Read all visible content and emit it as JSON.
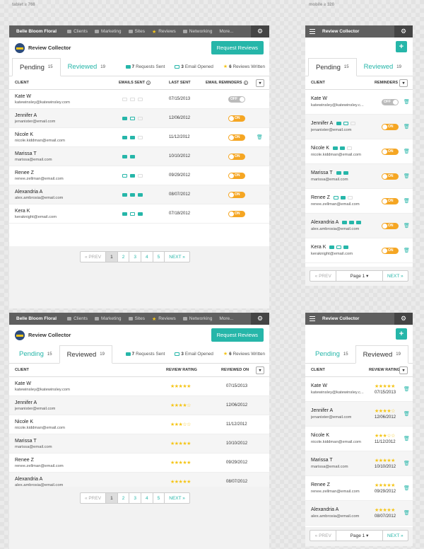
{
  "labels": {
    "tablet": "tablet ≥ 768",
    "mobile": "mobile ≥ 320"
  },
  "nav": {
    "brand": "Belle Bloom Floral",
    "items": [
      "Clients",
      "Marketing",
      "Sites",
      "Reviews",
      "Networking",
      "More..."
    ],
    "mobile_title": "Review Collector"
  },
  "app": {
    "title": "Review Collector",
    "request_button": "Request Reviews",
    "plus": "+"
  },
  "tabs": {
    "pending": "Pending",
    "pending_count": "15",
    "reviewed": "Reviewed",
    "reviewed_count": "19"
  },
  "stats": {
    "requests_sent_n": "7",
    "requests_sent": "Requests Sent",
    "email_opened_n": "3",
    "email_opened": "Email Opened",
    "reviews_written_n": "6",
    "reviews_written": "Reviews Written"
  },
  "headers": {
    "client": "CLIENT",
    "emails_sent": "EMAILS SENT",
    "last_sent": "LAST SENT",
    "email_reminders": "EMAIL REMINDERS",
    "reminders": "REMINDERS",
    "review_rating": "REVIEW RATING",
    "reviewed_on": "REVIEWED ON"
  },
  "clients": [
    {
      "name": "Kate W",
      "email": "katewinsley@katewinsley.com",
      "mobile_email": "katewinsley@katewinsley.c...",
      "last_sent": "07/15/2013",
      "reminder": "OFF",
      "stars": "★★★★★",
      "reviewed_on": "07/15/2013"
    },
    {
      "name": "Jennifer A",
      "email": "jenanister@email.com",
      "mobile_email": "jenanister@email.com",
      "last_sent": "12/06/2012",
      "reminder": "ON",
      "stars": "★★★★☆",
      "reviewed_on": "12/06/2012"
    },
    {
      "name": "Nicole K",
      "email": "nicole.kiddman@email.com",
      "mobile_email": "nicole.kiddman@email.com",
      "last_sent": "11/12/2012",
      "reminder": "ON",
      "stars": "★★★☆☆",
      "reviewed_on": "11/12/2012"
    },
    {
      "name": "Marissa T",
      "email": "marissa@email.com",
      "mobile_email": "marissa@email.com",
      "last_sent": "10/10/2012",
      "reminder": "ON",
      "stars": "★★★★★",
      "reviewed_on": "10/10/2012"
    },
    {
      "name": "Renee Z",
      "email": "renee.zellman@email.com",
      "mobile_email": "renee.zellman@email.com",
      "last_sent": "09/29/2012",
      "reminder": "ON",
      "stars": "★★★★★",
      "reviewed_on": "09/29/2012"
    },
    {
      "name": "Alexandria A",
      "email": "alex.ambrosia@email.com",
      "mobile_email": "alex.ambrosia@email.com",
      "last_sent": "08/07/2012",
      "reminder": "ON",
      "stars": "★★★★★",
      "reviewed_on": "08/07/2012"
    },
    {
      "name": "Kera K",
      "email": "keraknight@email.com",
      "mobile_email": "keraknight@email.com",
      "last_sent": "07/18/2012",
      "reminder": "ON",
      "stars": "",
      "reviewed_on": ""
    }
  ],
  "pagination": {
    "prev": "« PREV",
    "pages": [
      "1",
      "2",
      "3",
      "4",
      "5"
    ],
    "next": "NEXT »",
    "mobile_page": "Page 1 ▾"
  },
  "colors": {
    "accent": "#26b6a9",
    "toggle_on": "#f5a623",
    "star": "#f5c518",
    "navbar": "#5f5f5f"
  }
}
